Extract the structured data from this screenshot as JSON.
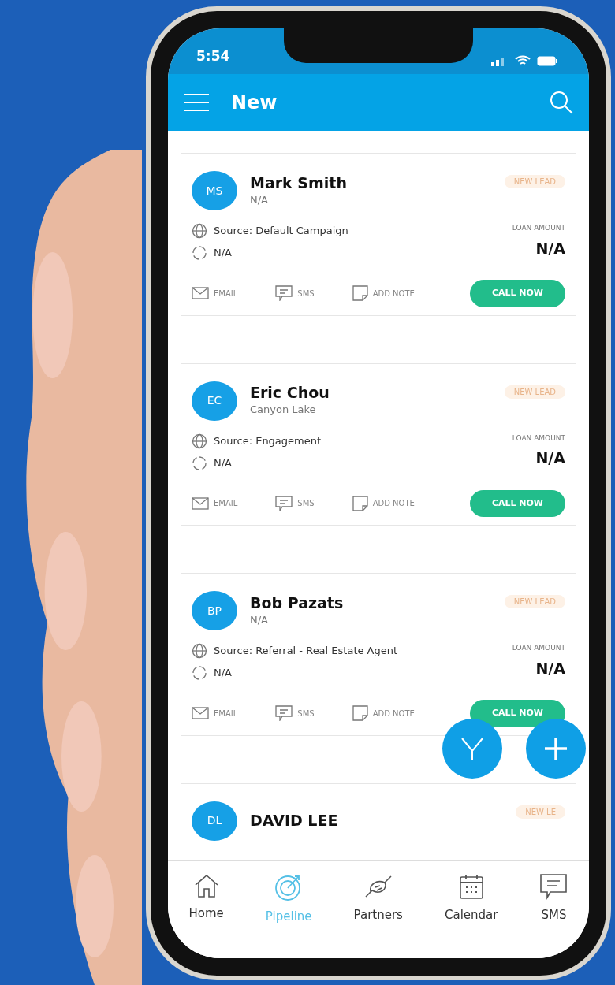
{
  "status_bar": {
    "time": "5:54"
  },
  "app_bar": {
    "title": "New"
  },
  "leads": [
    {
      "initials": "MS",
      "name": "Mark Smith",
      "subtitle": "N/A",
      "badge": "NEW LEAD",
      "source": "Source: Default Campaign",
      "location": "N/A",
      "loan_label": "LOAN AMOUNT",
      "loan_amount": "N/A",
      "actions": [
        "EMAIL",
        "SMS",
        "ADD NOTE"
      ],
      "call_button": "CALL NOW"
    },
    {
      "initials": "EC",
      "name": "Eric Chou",
      "subtitle": "Canyon Lake",
      "badge": "NEW LEAD",
      "source": "Source: Engagement",
      "location": "N/A",
      "loan_label": "LOAN AMOUNT",
      "loan_amount": "N/A",
      "actions": [
        "EMAIL",
        "SMS",
        "ADD NOTE"
      ],
      "call_button": "CALL NOW"
    },
    {
      "initials": "BP",
      "name": "Bob Pazats",
      "subtitle": "N/A",
      "badge": "NEW LEAD",
      "source": "Source: Referral - Real Estate Agent",
      "location": "N/A",
      "loan_label": "LOAN AMOUNT",
      "loan_amount": "N/A",
      "actions": [
        "EMAIL",
        "SMS",
        "ADD NOTE"
      ],
      "call_button": "CALL NOW"
    },
    {
      "initials": "DL",
      "name": "DAVID LEE",
      "badge": "NEW LE"
    }
  ],
  "bottom_nav": [
    {
      "kind": "home",
      "label": "Home",
      "selected": false
    },
    {
      "kind": "pipeline",
      "label": "Pipeline",
      "selected": true
    },
    {
      "kind": "partners",
      "label": "Partners",
      "selected": false
    },
    {
      "kind": "calendar",
      "label": "Calendar",
      "selected": false
    },
    {
      "kind": "sms",
      "label": "SMS",
      "selected": false
    }
  ]
}
